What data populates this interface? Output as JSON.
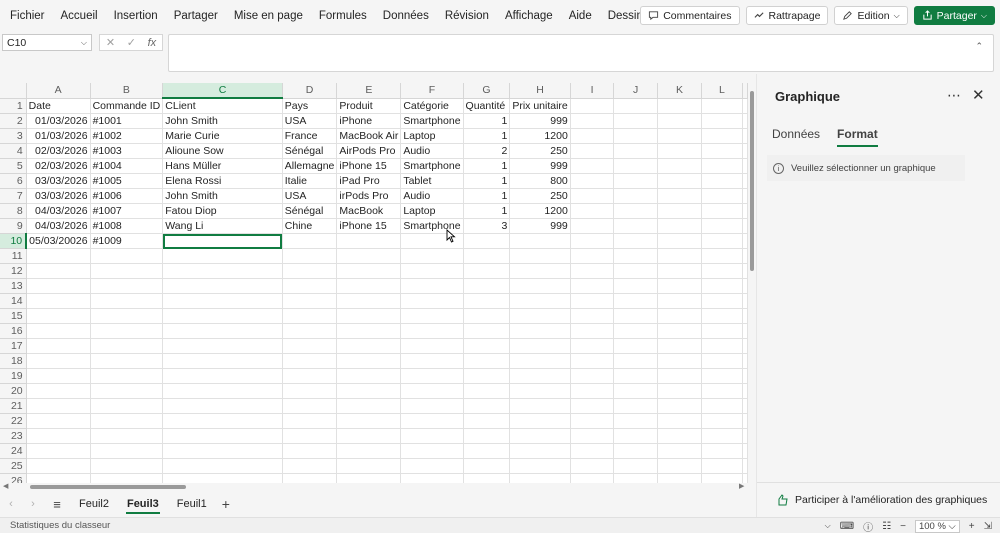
{
  "menu": {
    "items": [
      "Fichier",
      "Accueil",
      "Insertion",
      "Partager",
      "Mise en page",
      "Formules",
      "Données",
      "Révision",
      "Affichage",
      "Aide",
      "Dessin"
    ],
    "comments_label": "Commentaires",
    "catchup_label": "Rattrapage",
    "edit_label": "Edition",
    "share_label": "Partager"
  },
  "formula_bar": {
    "name_box": "C10",
    "fx_label": "fx",
    "value": ""
  },
  "sheet": {
    "columns": [
      "A",
      "B",
      "C",
      "D",
      "E",
      "F",
      "G",
      "H",
      "I",
      "J",
      "K",
      "L"
    ],
    "active_column": "C",
    "active_row": 10,
    "row_count": 26,
    "rows": [
      [
        "Date",
        "Commande ID",
        "CLient",
        "Pays",
        "Produit",
        "Catégorie",
        "Quantité",
        "Prix unitaire"
      ],
      [
        "01/03/2026",
        "#1001",
        "John Smith",
        "USA",
        "iPhone",
        "Smartphone",
        "1",
        "999"
      ],
      [
        "01/03/2026",
        "#1002",
        "Marie Curie",
        "France",
        "MacBook Air",
        "Laptop",
        "1",
        "1200"
      ],
      [
        "02/03/2026",
        "#1003",
        "Alioune Sow",
        "Sénégal",
        "AirPods Pro",
        "Audio",
        "2",
        "250"
      ],
      [
        "02/03/2026",
        "#1004",
        "Hans Müller",
        "Allemagne",
        "iPhone 15",
        "Smartphone",
        "1",
        "999"
      ],
      [
        "03/03/2026",
        "#1005",
        "Elena Rossi",
        "Italie",
        "iPad Pro",
        "Tablet",
        "1",
        "800"
      ],
      [
        "03/03/2026",
        "#1006",
        "John Smith",
        "USA",
        "irPods Pro",
        "Audio",
        "1",
        "250"
      ],
      [
        "04/03/2026",
        "#1007",
        "Fatou Diop",
        "Sénégal",
        "MacBook",
        "Laptop",
        "1",
        "1200"
      ],
      [
        "04/03/2026",
        "#1008",
        "Wang Li",
        "Chine",
        "iPhone 15",
        "Smartphone",
        "3",
        "999"
      ],
      [
        "05/03/20026",
        "#1009",
        "",
        "",
        "",
        "",
        "",
        ""
      ]
    ]
  },
  "tabs": {
    "items": [
      "Feuil2",
      "Feuil3",
      "Feuil1"
    ],
    "active": "Feuil3"
  },
  "status": {
    "left": "Statistiques du classeur",
    "zoom": "100 %"
  },
  "pane": {
    "title": "Graphique",
    "tabs": [
      "Données",
      "Format"
    ],
    "active_tab": "Format",
    "info": "Veuillez sélectionner un graphique",
    "feedback": "Participer à l'amélioration des graphiques"
  },
  "colors": {
    "accent": "#107c41"
  }
}
